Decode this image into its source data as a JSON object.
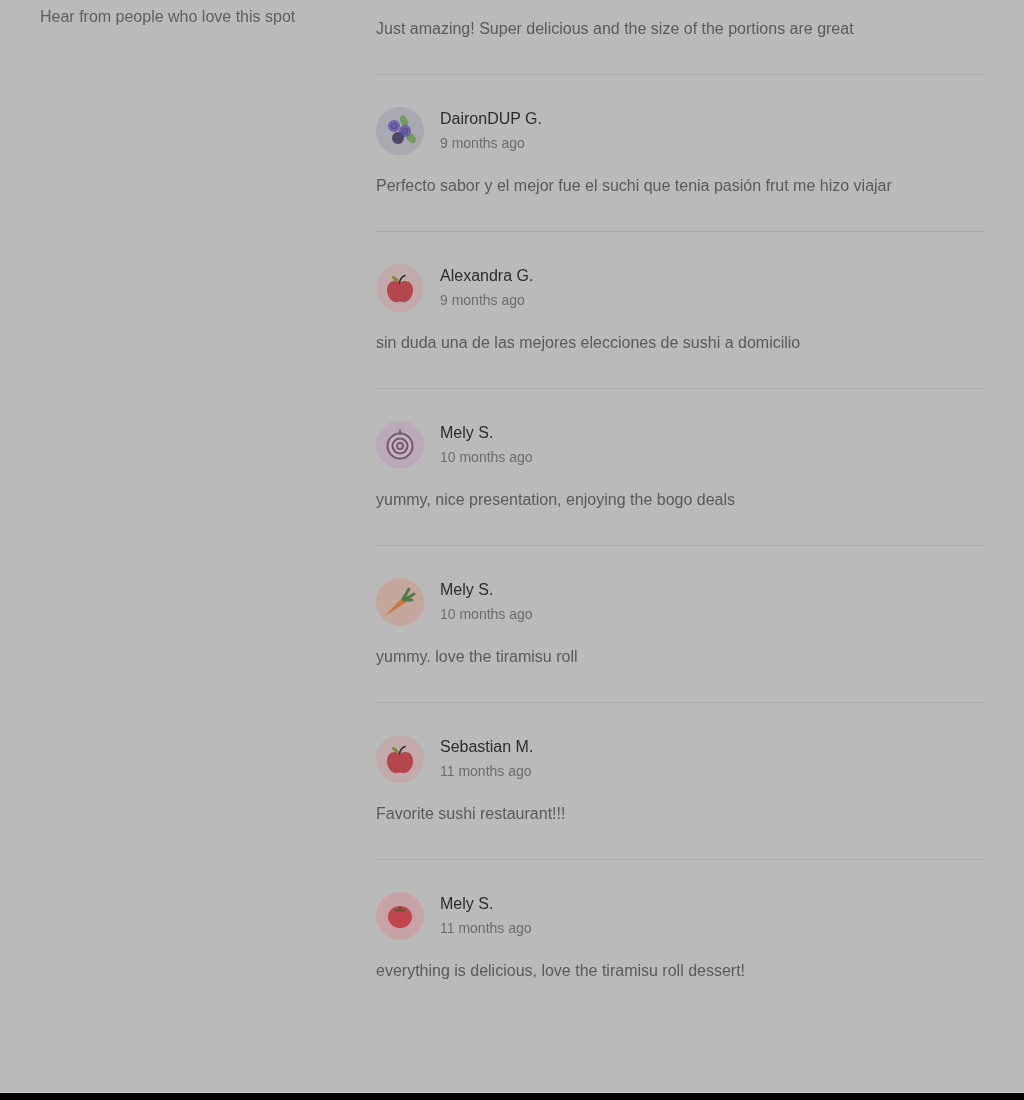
{
  "intro": {
    "text": "Hear from people who love this spot"
  },
  "reviews": [
    {
      "text": "Just amazing! Super delicious and the size of the portions are great"
    },
    {
      "author": "DaironDUP G.",
      "time": "9 months ago",
      "avatar": {
        "kind": "blueberries"
      },
      "text": "Perfecto sabor y el mejor fue el suchi que tenia pasión frut me hizo viajar"
    },
    {
      "author": "Alexandra G.",
      "time": "9 months ago",
      "avatar": {
        "kind": "apple"
      },
      "text": "sin duda una de las mejores elecciones de sushi a domicilio"
    },
    {
      "author": "Mely S.",
      "time": "10 months ago",
      "avatar": {
        "kind": "onion"
      },
      "text": "yummy, nice presentation, enjoying the bogo deals"
    },
    {
      "author": "Mely S.",
      "time": "10 months ago",
      "avatar": {
        "kind": "carrot"
      },
      "text": "yummy. love the tiramisu roll"
    },
    {
      "author": "Sebastian M.",
      "time": "11 months ago",
      "avatar": {
        "kind": "apple"
      },
      "text": "Favorite sushi restaurant!!!"
    },
    {
      "author": "Mely S.",
      "time": "11 months ago",
      "avatar": {
        "kind": "tomato"
      },
      "text": "everything is delicious, love the tiramisu roll dessert!"
    }
  ]
}
